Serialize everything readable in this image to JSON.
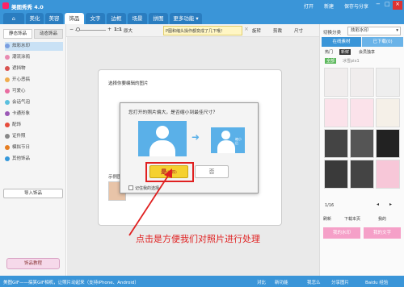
{
  "app": {
    "title": "美图秀秀 4.0",
    "top_open": "打开",
    "top_new": "新建",
    "top_save": "保存与分享"
  },
  "menu": {
    "tabs": [
      "美化",
      "美容",
      "饰品",
      "文字",
      "边框",
      "场景",
      "拼图"
    ],
    "more": "更多功能"
  },
  "toolbar": {
    "size_label": "1:1",
    "size_label2": "原大",
    "hint": "P图和缩头操作都变成了几下哦！",
    "rotate": "旋转",
    "crop": "剪裁",
    "resize": "尺寸"
  },
  "left": {
    "tab1": "静态饰品",
    "tab2": "动态饰品",
    "items": [
      "炫彩水印",
      "潮流涂鸦",
      "遮挡物",
      "开心恶搞",
      "可爱心",
      "会话气泡",
      "卡通形象",
      "配饰",
      "证件照",
      "模拟节日",
      "其他饰品"
    ],
    "import": "导入饰品",
    "tutorial": "饰品教程"
  },
  "canvas": {
    "select_text": "选择你要编辑的图片",
    "sample_text": "示例图片"
  },
  "dialog": {
    "question": "您打开的照片偏大，是否缩小到最佳尺寸？",
    "after_label": "缩小后",
    "yes": "是",
    "yes_sub": "(推荐)",
    "no": "否",
    "remember": "记住我的选择"
  },
  "annotation": {
    "text": "点击是方便我们对照片进行处理"
  },
  "right": {
    "cat_label": "切换分类",
    "cat_value": "炫彩水印",
    "tab_online": "在线素材",
    "tab_used": "已下载(0)",
    "sub_hot": "热门",
    "sub_new": "新鲜",
    "sub_vip": "会员独享",
    "filter_all": "全部",
    "filter_name": "冰雪pix1",
    "page": "1/16",
    "refresh": "刷新",
    "dl_page": "下载本页",
    "mine": "我的",
    "btn1": "我的水印",
    "btn2": "我的文字"
  },
  "status": {
    "left": "美图GIF——搞笑GIF相机，让照片动起来（支持iPhone、Android）",
    "zoom": "对比",
    "compare": "新功能",
    "right1": "我怎么",
    "right2": "分享图片",
    "watermark": "Baidu 经验"
  }
}
